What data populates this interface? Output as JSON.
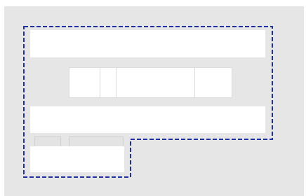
{
  "colors": {
    "page_background": "#ffffff",
    "canvas_background": "#e6e6e6",
    "panel_fill": "#ffffff",
    "cell_border": "#dcdcdc",
    "tab_fill": "#e3e3e3",
    "tab_border": "#cfcfcf",
    "selection_outline": "#1f2fa8"
  },
  "selection": {
    "style": "dashed"
  }
}
